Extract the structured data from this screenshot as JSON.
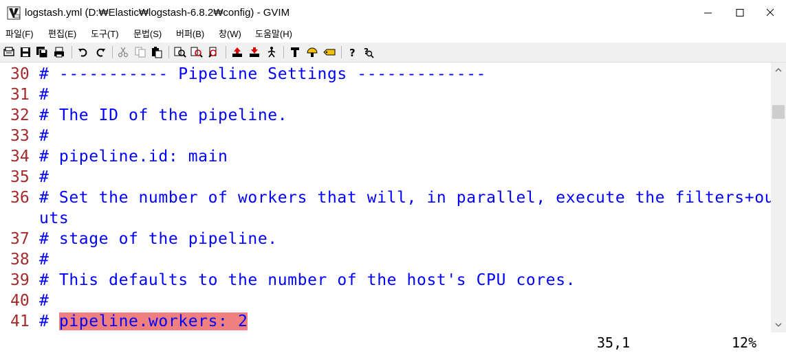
{
  "window": {
    "title": "logstash.yml (D:₩Elastic₩logstash-6.8.2₩config) - GVIM",
    "icon": "gvim-icon"
  },
  "menu": [
    "파일(F)",
    "편집(E)",
    "도구(T)",
    "문법(S)",
    "버퍼(B)",
    "창(W)",
    "도움말(H)"
  ],
  "toolbar": {
    "buttons": [
      "open-icon",
      "save-icon",
      "save-all-icon",
      "print-icon",
      "undo-icon",
      "redo-icon",
      "cut-icon",
      "copy-icon",
      "paste-icon",
      "find-replace-icon",
      "find-next-icon",
      "find-prev-icon",
      "load-session-icon",
      "save-session-icon",
      "run-script-icon",
      "make-icon",
      "shell-icon",
      "run-ctags-icon",
      "tag-jump-icon",
      "help-icon",
      "find-help-icon"
    ]
  },
  "editor": {
    "lines": [
      {
        "num": "30",
        "text": "# ----------- Pipeline Settings -------------"
      },
      {
        "num": "31",
        "text": "#"
      },
      {
        "num": "32",
        "text": "# The ID of the pipeline."
      },
      {
        "num": "33",
        "text": "#"
      },
      {
        "num": "34",
        "text": "# pipeline.id: main"
      },
      {
        "num": "35",
        "text": "#"
      },
      {
        "num": "36",
        "text": "# Set the number of workers that will, in parallel, execute the filters+outp"
      },
      {
        "num": "",
        "text": "uts"
      },
      {
        "num": "37",
        "text": "# stage of the pipeline."
      },
      {
        "num": "38",
        "text": "#"
      },
      {
        "num": "39",
        "text": "# This defaults to the number of the host's CPU cores."
      },
      {
        "num": "40",
        "text": "#"
      },
      {
        "num": "41",
        "text_prefix": "# ",
        "text_highlight": "pipeline.workers: 2"
      }
    ],
    "highlight_color": "#f08080",
    "line_number_color": "#a52a2a",
    "comment_color": "#0000ff"
  },
  "status": {
    "position": "35,1",
    "percent": "12%"
  }
}
